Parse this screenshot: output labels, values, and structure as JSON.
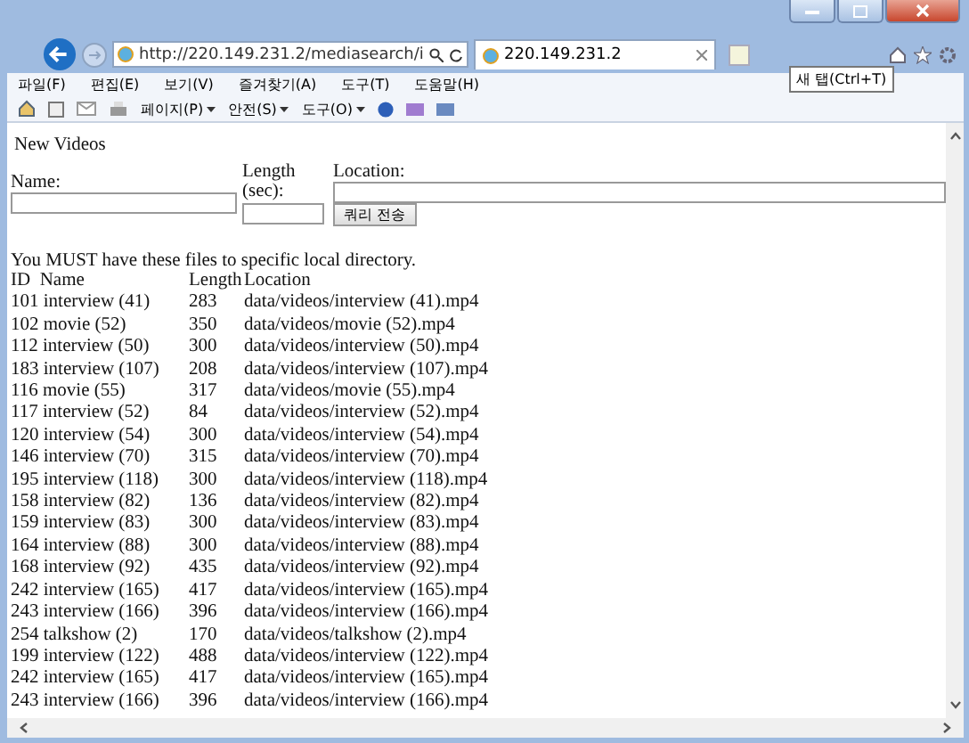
{
  "browser": {
    "address": "http://220.149.231.2/mediasearch/i",
    "tab": {
      "label": "220.149.231.2",
      "selected": true
    },
    "tooltip": "새 탭(Ctrl+T)",
    "menu": [
      "파일(F)",
      "편집(E)",
      "보기(V)",
      "즐겨찾기(A)",
      "도구(T)",
      "도움말(H)"
    ],
    "commands": [
      "페이지(P)",
      "안전(S)",
      "도구(O)"
    ]
  },
  "form": {
    "title": "New Videos",
    "name_label": "Name:",
    "length_label": "Length (sec):",
    "location_label": "Location:",
    "submit": "쿼리 전송"
  },
  "notice": "You MUST have these files to specific local directory.",
  "table": {
    "columns": [
      "ID  Name",
      "Length",
      "Location"
    ],
    "rows": [
      {
        "item": "101 interview (41)",
        "length": "283",
        "location": "data/videos/interview (41).mp4"
      },
      {
        "item": "102 movie (52)",
        "length": "350",
        "location": "data/videos/movie (52).mp4"
      },
      {
        "item": "112 interview (50)",
        "length": "300",
        "location": "data/videos/interview (50).mp4"
      },
      {
        "item": "183 interview (107)",
        "length": "208",
        "location": "data/videos/interview (107).mp4"
      },
      {
        "item": "116 movie (55)",
        "length": "317",
        "location": "data/videos/movie (55).mp4"
      },
      {
        "item": "117 interview (52)",
        "length": "84",
        "location": "data/videos/interview (52).mp4"
      },
      {
        "item": "120 interview (54)",
        "length": "300",
        "location": "data/videos/interview (54).mp4"
      },
      {
        "item": "146 interview (70)",
        "length": "315",
        "location": "data/videos/interview (70).mp4"
      },
      {
        "item": "195 interview (118)",
        "length": "300",
        "location": "data/videos/interview (118).mp4"
      },
      {
        "item": "158 interview (82)",
        "length": "136",
        "location": "data/videos/interview (82).mp4"
      },
      {
        "item": "159 interview (83)",
        "length": "300",
        "location": "data/videos/interview (83).mp4"
      },
      {
        "item": "164 interview (88)",
        "length": "300",
        "location": "data/videos/interview (88).mp4"
      },
      {
        "item": "168 interview (92)",
        "length": "435",
        "location": "data/videos/interview (92).mp4"
      },
      {
        "item": "242 interview (165)",
        "length": "417",
        "location": "data/videos/interview (165).mp4"
      },
      {
        "item": "243 interview (166)",
        "length": "396",
        "location": "data/videos/interview (166).mp4"
      },
      {
        "item": "254 talkshow (2)",
        "length": "170",
        "location": "data/videos/talkshow (2).mp4"
      },
      {
        "item": "199 interview (122)",
        "length": "488",
        "location": "data/videos/interview (122).mp4"
      },
      {
        "item": "242 interview (165)",
        "length": "417",
        "location": "data/videos/interview (165).mp4"
      },
      {
        "item": "243 interview (166)",
        "length": "396",
        "location": "data/videos/interview (166).mp4"
      }
    ]
  }
}
